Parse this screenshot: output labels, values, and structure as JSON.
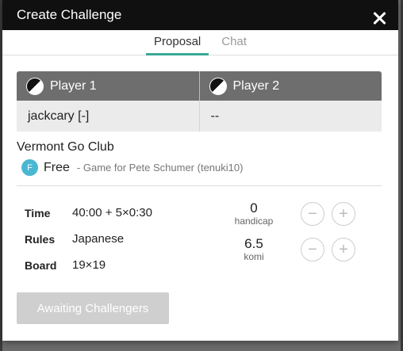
{
  "dialog": {
    "title": "Create Challenge"
  },
  "tabs": [
    {
      "label": "Proposal",
      "active": true
    },
    {
      "label": "Chat",
      "active": false
    }
  ],
  "players": {
    "headers": [
      "Player 1",
      "Player 2"
    ],
    "values": [
      "jackcary [-]",
      "--"
    ]
  },
  "group": {
    "club_name": "Vermont Go Club",
    "badge_letter": "F",
    "free_label": "Free",
    "description": "- Game for Pete Schumer (tenuki10)"
  },
  "settings": [
    {
      "label": "Time",
      "value": "40:00 + 5×0:30"
    },
    {
      "label": "Rules",
      "value": "Japanese"
    },
    {
      "label": "Board",
      "value": "19×19"
    }
  ],
  "handicap": {
    "value": "0",
    "caption": "handicap",
    "minus": "−",
    "plus": "+"
  },
  "komi": {
    "value": "6.5",
    "caption": "komi",
    "minus": "−",
    "plus": "+"
  },
  "action": {
    "label": "Awaiting Challengers"
  },
  "colors": {
    "accent": "#3aa897",
    "badge": "#4ab7d2",
    "header_bg": "#6e6e6e"
  }
}
